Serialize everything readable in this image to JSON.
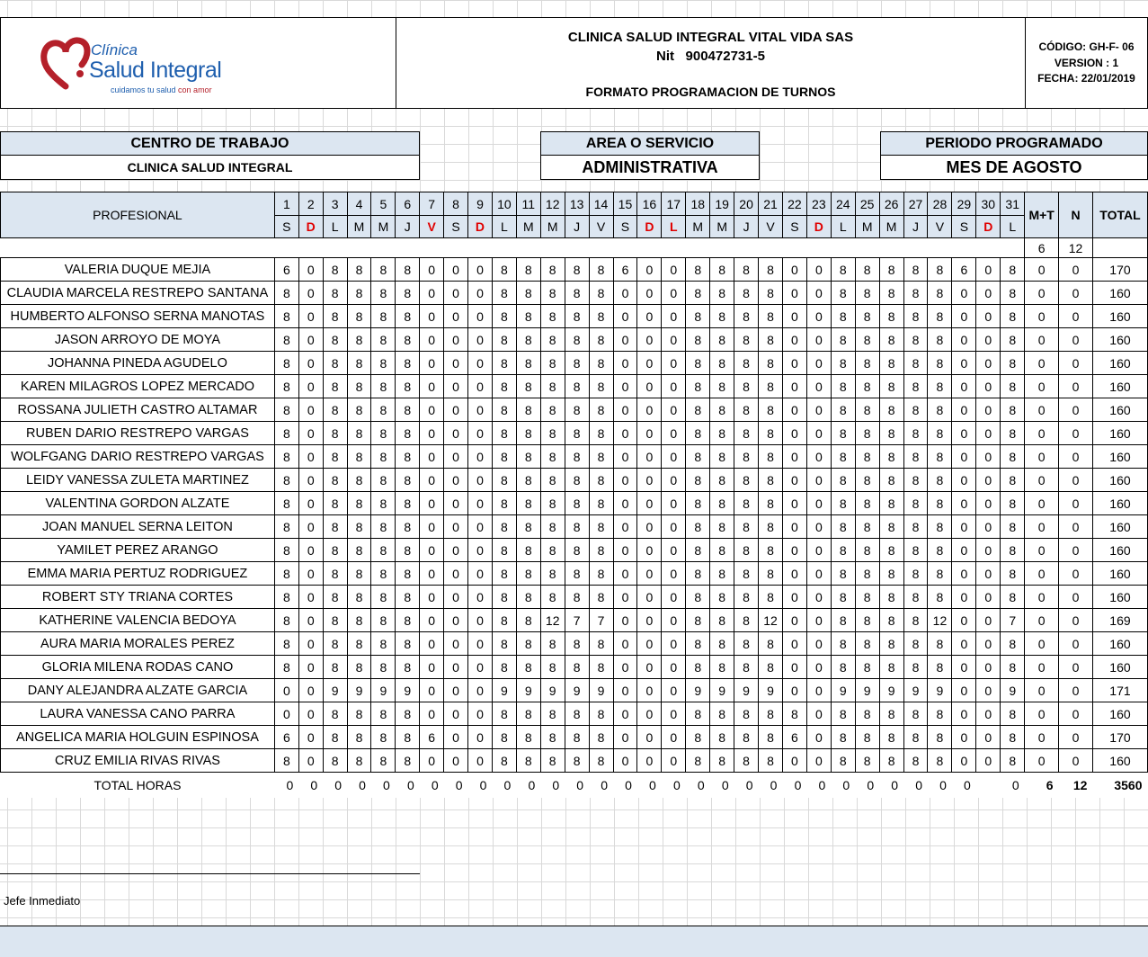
{
  "header": {
    "logo": {
      "line1": "Clínica",
      "line2": "Salud Integral",
      "tagline_a": "cuidamos tu salud ",
      "tagline_b": "con amor"
    },
    "company_name": "CLINICA SALUD INTEGRAL VITAL VIDA SAS",
    "nit": "Nit   900472731-5",
    "form_title": "FORMATO PROGRAMACION DE TURNOS",
    "code": "CÓDIGO: GH-F- 06",
    "version": "VERSION : 1",
    "date": "FECHA: 22/01/2019"
  },
  "info": {
    "work_center_label": "CENTRO DE TRABAJO",
    "work_center_value": "CLINICA SALUD INTEGRAL",
    "area_label": "AREA O SERVICIO",
    "area_value": "ADMINISTRATIVA",
    "period_label": "PERIODO PROGRAMADO",
    "period_value": "MES DE AGOSTO"
  },
  "table": {
    "professional_label": "PROFESIONAL",
    "mt_label": "M+T",
    "n_label": "N",
    "total_label": "TOTAL",
    "days": [
      "1",
      "2",
      "3",
      "4",
      "5",
      "6",
      "7",
      "8",
      "9",
      "10",
      "11",
      "12",
      "13",
      "14",
      "15",
      "16",
      "17",
      "18",
      "19",
      "20",
      "21",
      "22",
      "23",
      "24",
      "25",
      "26",
      "27",
      "28",
      "29",
      "30",
      "31"
    ],
    "weekdays": [
      "S",
      "D",
      "L",
      "M",
      "M",
      "J",
      "V",
      "S",
      "D",
      "L",
      "M",
      "M",
      "J",
      "V",
      "S",
      "D",
      "L",
      "M",
      "M",
      "J",
      "V",
      "S",
      "D",
      "L",
      "M",
      "M",
      "J",
      "V",
      "S",
      "D",
      "L"
    ],
    "highlight_weekday_indices": [
      1,
      6,
      8,
      15,
      16,
      22,
      29
    ],
    "highlight_color": "#e00000",
    "mt_count": "6",
    "n_count": "12",
    "rows": [
      {
        "name": "VALERIA DUQUE MEJIA",
        "values": [
          "6",
          "0",
          "8",
          "8",
          "8",
          "8",
          "0",
          "0",
          "0",
          "8",
          "8",
          "8",
          "8",
          "8",
          "6",
          "0",
          "0",
          "8",
          "8",
          "8",
          "8",
          "0",
          "0",
          "8",
          "8",
          "8",
          "8",
          "8",
          "6",
          "0",
          "8"
        ],
        "mt": "0",
        "n": "0",
        "total": "170"
      },
      {
        "name": "CLAUDIA MARCELA RESTREPO SANTANA",
        "values": [
          "8",
          "0",
          "8",
          "8",
          "8",
          "8",
          "0",
          "0",
          "0",
          "8",
          "8",
          "8",
          "8",
          "8",
          "0",
          "0",
          "0",
          "8",
          "8",
          "8",
          "8",
          "0",
          "0",
          "8",
          "8",
          "8",
          "8",
          "8",
          "0",
          "0",
          "8"
        ],
        "mt": "0",
        "n": "0",
        "total": "160"
      },
      {
        "name": "HUMBERTO ALFONSO SERNA MANOTAS",
        "values": [
          "8",
          "0",
          "8",
          "8",
          "8",
          "8",
          "0",
          "0",
          "0",
          "8",
          "8",
          "8",
          "8",
          "8",
          "0",
          "0",
          "0",
          "8",
          "8",
          "8",
          "8",
          "0",
          "0",
          "8",
          "8",
          "8",
          "8",
          "8",
          "0",
          "0",
          "8"
        ],
        "mt": "0",
        "n": "0",
        "total": "160"
      },
      {
        "name": "JASON ARROYO DE MOYA",
        "values": [
          "8",
          "0",
          "8",
          "8",
          "8",
          "8",
          "0",
          "0",
          "0",
          "8",
          "8",
          "8",
          "8",
          "8",
          "0",
          "0",
          "0",
          "8",
          "8",
          "8",
          "8",
          "0",
          "0",
          "8",
          "8",
          "8",
          "8",
          "8",
          "0",
          "0",
          "8"
        ],
        "mt": "0",
        "n": "0",
        "total": "160"
      },
      {
        "name": "JOHANNA  PINEDA AGUDELO",
        "values": [
          "8",
          "0",
          "8",
          "8",
          "8",
          "8",
          "0",
          "0",
          "0",
          "8",
          "8",
          "8",
          "8",
          "8",
          "0",
          "0",
          "0",
          "8",
          "8",
          "8",
          "8",
          "0",
          "0",
          "8",
          "8",
          "8",
          "8",
          "8",
          "0",
          "0",
          "8"
        ],
        "mt": "0",
        "n": "0",
        "total": "160"
      },
      {
        "name": "KAREN MILAGROS LOPEZ MERCADO",
        "values": [
          "8",
          "0",
          "8",
          "8",
          "8",
          "8",
          "0",
          "0",
          "0",
          "8",
          "8",
          "8",
          "8",
          "8",
          "0",
          "0",
          "0",
          "8",
          "8",
          "8",
          "8",
          "0",
          "0",
          "8",
          "8",
          "8",
          "8",
          "8",
          "0",
          "0",
          "8"
        ],
        "mt": "0",
        "n": "0",
        "total": "160"
      },
      {
        "name": "ROSSANA JULIETH CASTRO ALTAMAR",
        "values": [
          "8",
          "0",
          "8",
          "8",
          "8",
          "8",
          "0",
          "0",
          "0",
          "8",
          "8",
          "8",
          "8",
          "8",
          "0",
          "0",
          "0",
          "8",
          "8",
          "8",
          "8",
          "0",
          "0",
          "8",
          "8",
          "8",
          "8",
          "8",
          "0",
          "0",
          "8"
        ],
        "mt": "0",
        "n": "0",
        "total": "160"
      },
      {
        "name": "RUBEN DARIO RESTREPO VARGAS",
        "values": [
          "8",
          "0",
          "8",
          "8",
          "8",
          "8",
          "0",
          "0",
          "0",
          "8",
          "8",
          "8",
          "8",
          "8",
          "0",
          "0",
          "0",
          "8",
          "8",
          "8",
          "8",
          "0",
          "0",
          "8",
          "8",
          "8",
          "8",
          "8",
          "0",
          "0",
          "8"
        ],
        "mt": "0",
        "n": "0",
        "total": "160"
      },
      {
        "name": "WOLFGANG DARIO RESTREPO VARGAS",
        "values": [
          "8",
          "0",
          "8",
          "8",
          "8",
          "8",
          "0",
          "0",
          "0",
          "8",
          "8",
          "8",
          "8",
          "8",
          "0",
          "0",
          "0",
          "8",
          "8",
          "8",
          "8",
          "0",
          "0",
          "8",
          "8",
          "8",
          "8",
          "8",
          "0",
          "0",
          "8"
        ],
        "mt": "0",
        "n": "0",
        "total": "160"
      },
      {
        "name": "LEIDY VANESSA ZULETA MARTINEZ",
        "values": [
          "8",
          "0",
          "8",
          "8",
          "8",
          "8",
          "0",
          "0",
          "0",
          "8",
          "8",
          "8",
          "8",
          "8",
          "0",
          "0",
          "0",
          "8",
          "8",
          "8",
          "8",
          "0",
          "0",
          "8",
          "8",
          "8",
          "8",
          "8",
          "0",
          "0",
          "8"
        ],
        "mt": "0",
        "n": "0",
        "total": "160"
      },
      {
        "name": "VALENTINA GORDON ALZATE",
        "values": [
          "8",
          "0",
          "8",
          "8",
          "8",
          "8",
          "0",
          "0",
          "0",
          "8",
          "8",
          "8",
          "8",
          "8",
          "0",
          "0",
          "0",
          "8",
          "8",
          "8",
          "8",
          "0",
          "0",
          "8",
          "8",
          "8",
          "8",
          "8",
          "0",
          "0",
          "8"
        ],
        "mt": "0",
        "n": "0",
        "total": "160"
      },
      {
        "name": "JOAN MANUEL SERNA LEITON",
        "values": [
          "8",
          "0",
          "8",
          "8",
          "8",
          "8",
          "0",
          "0",
          "0",
          "8",
          "8",
          "8",
          "8",
          "8",
          "0",
          "0",
          "0",
          "8",
          "8",
          "8",
          "8",
          "0",
          "0",
          "8",
          "8",
          "8",
          "8",
          "8",
          "0",
          "0",
          "8"
        ],
        "mt": "0",
        "n": "0",
        "total": "160"
      },
      {
        "name": "YAMILET PEREZ ARANGO",
        "values": [
          "8",
          "0",
          "8",
          "8",
          "8",
          "8",
          "0",
          "0",
          "0",
          "8",
          "8",
          "8",
          "8",
          "8",
          "0",
          "0",
          "0",
          "8",
          "8",
          "8",
          "8",
          "0",
          "0",
          "8",
          "8",
          "8",
          "8",
          "8",
          "0",
          "0",
          "8"
        ],
        "mt": "0",
        "n": "0",
        "total": "160"
      },
      {
        "name": "EMMA MARIA PERTUZ RODRIGUEZ",
        "values": [
          "8",
          "0",
          "8",
          "8",
          "8",
          "8",
          "0",
          "0",
          "0",
          "8",
          "8",
          "8",
          "8",
          "8",
          "0",
          "0",
          "0",
          "8",
          "8",
          "8",
          "8",
          "0",
          "0",
          "8",
          "8",
          "8",
          "8",
          "8",
          "0",
          "0",
          "8"
        ],
        "mt": "0",
        "n": "0",
        "total": "160"
      },
      {
        "name": "ROBERT STY TRIANA CORTES",
        "values": [
          "8",
          "0",
          "8",
          "8",
          "8",
          "8",
          "0",
          "0",
          "0",
          "8",
          "8",
          "8",
          "8",
          "8",
          "0",
          "0",
          "0",
          "8",
          "8",
          "8",
          "8",
          "0",
          "0",
          "8",
          "8",
          "8",
          "8",
          "8",
          "0",
          "0",
          "8"
        ],
        "mt": "0",
        "n": "0",
        "total": "160"
      },
      {
        "name": "KATHERINE VALENCIA BEDOYA",
        "values": [
          "8",
          "0",
          "8",
          "8",
          "8",
          "8",
          "0",
          "0",
          "0",
          "8",
          "8",
          "12",
          "7",
          "7",
          "0",
          "0",
          "0",
          "8",
          "8",
          "8",
          "12",
          "0",
          "0",
          "8",
          "8",
          "8",
          "8",
          "12",
          "0",
          "0",
          "7"
        ],
        "mt": "0",
        "n": "0",
        "total": "169"
      },
      {
        "name": "AURA MARIA MORALES PEREZ",
        "values": [
          "8",
          "0",
          "8",
          "8",
          "8",
          "8",
          "0",
          "0",
          "0",
          "8",
          "8",
          "8",
          "8",
          "8",
          "0",
          "0",
          "0",
          "8",
          "8",
          "8",
          "8",
          "0",
          "0",
          "8",
          "8",
          "8",
          "8",
          "8",
          "0",
          "0",
          "8"
        ],
        "mt": "0",
        "n": "0",
        "total": "160"
      },
      {
        "name": "GLORIA MILENA RODAS CANO",
        "values": [
          "8",
          "0",
          "8",
          "8",
          "8",
          "8",
          "0",
          "0",
          "0",
          "8",
          "8",
          "8",
          "8",
          "8",
          "0",
          "0",
          "0",
          "8",
          "8",
          "8",
          "8",
          "0",
          "0",
          "8",
          "8",
          "8",
          "8",
          "8",
          "0",
          "0",
          "8"
        ],
        "mt": "0",
        "n": "0",
        "total": "160"
      },
      {
        "name": "DANY ALEJANDRA ALZATE GARCIA",
        "values": [
          "0",
          "0",
          "9",
          "9",
          "9",
          "9",
          "0",
          "0",
          "0",
          "9",
          "9",
          "9",
          "9",
          "9",
          "0",
          "0",
          "0",
          "9",
          "9",
          "9",
          "9",
          "0",
          "0",
          "9",
          "9",
          "9",
          "9",
          "9",
          "0",
          "0",
          "9"
        ],
        "mt": "0",
        "n": "0",
        "total": "171"
      },
      {
        "name": "LAURA VANESSA CANO PARRA",
        "values": [
          "0",
          "0",
          "8",
          "8",
          "8",
          "8",
          "0",
          "0",
          "0",
          "8",
          "8",
          "8",
          "8",
          "8",
          "0",
          "0",
          "0",
          "8",
          "8",
          "8",
          "8",
          "8",
          "0",
          "8",
          "8",
          "8",
          "8",
          "8",
          "0",
          "0",
          "8"
        ],
        "mt": "0",
        "n": "0",
        "total": "160"
      },
      {
        "name": "ANGELICA MARIA HOLGUIN ESPINOSA",
        "values": [
          "6",
          "0",
          "8",
          "8",
          "8",
          "8",
          "6",
          "0",
          "0",
          "8",
          "8",
          "8",
          "8",
          "8",
          "0",
          "0",
          "0",
          "8",
          "8",
          "8",
          "8",
          "6",
          "0",
          "8",
          "8",
          "8",
          "8",
          "8",
          "0",
          "0",
          "8"
        ],
        "mt": "0",
        "n": "0",
        "total": "170"
      },
      {
        "name": "CRUZ EMILIA RIVAS RIVAS",
        "values": [
          "8",
          "0",
          "8",
          "8",
          "8",
          "8",
          "0",
          "0",
          "0",
          "8",
          "8",
          "8",
          "8",
          "8",
          "0",
          "0",
          "0",
          "8",
          "8",
          "8",
          "8",
          "0",
          "0",
          "8",
          "8",
          "8",
          "8",
          "8",
          "0",
          "0",
          "8"
        ],
        "mt": "0",
        "n": "0",
        "total": "160"
      }
    ],
    "totals": {
      "label": "TOTAL HORAS",
      "days": [
        "0",
        "0",
        "0",
        "0",
        "0",
        "0",
        "0",
        "0",
        "0",
        "0",
        "0",
        "0",
        "0",
        "0",
        "0",
        "0",
        "0",
        "0",
        "0",
        "0",
        "0",
        "0",
        "0",
        "0",
        "0",
        "0",
        "0",
        "0",
        "0",
        "",
        "0"
      ],
      "mt": "6",
      "n": "12",
      "total": "3560"
    }
  },
  "footer": {
    "signature_label": "Jefe Inmediato"
  }
}
